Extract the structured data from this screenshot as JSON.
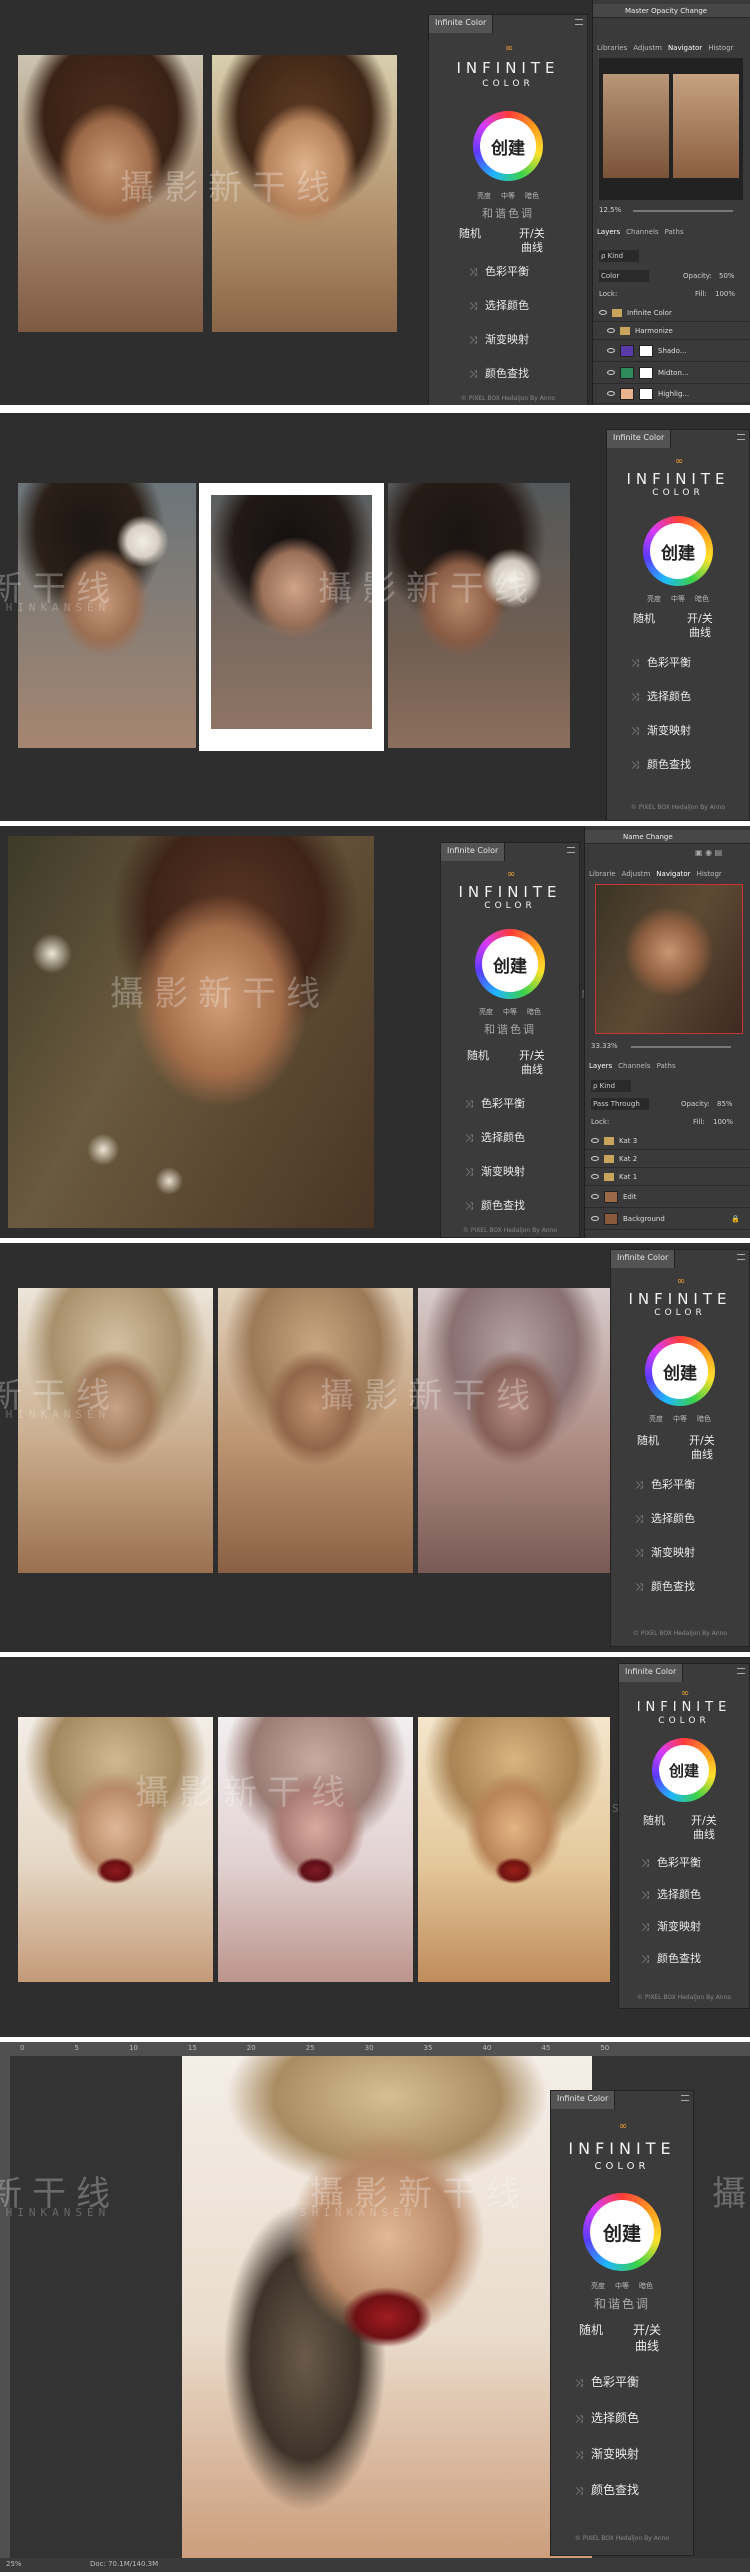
{
  "plugin": {
    "tab_label": "Infinite Color",
    "title": "INFINITE",
    "subtitle": "COLOR",
    "create": "创建",
    "options": [
      "亮度",
      "中等",
      "暗色"
    ],
    "harmony": "和谐色调",
    "random": "随机",
    "toggle_line1": "开/关",
    "toggle_line2": "曲线",
    "actions": [
      "色彩平衡",
      "选择颜色",
      "渐变映射",
      "颜色查找"
    ],
    "footer": "© PIXEL BOX Hedaljon By Anno"
  },
  "watermark": {
    "cn_full": "攝影新干线",
    "cn_short": "新干线",
    "en": "SHINKANSEN",
    "cn_right": "攝"
  },
  "ps1": {
    "history": "Master Opacity Change",
    "tabs": [
      "Libraries",
      "Adjustm",
      "Navigator",
      "Histogr"
    ],
    "zoom": "12.5%",
    "layers_tabs": [
      "Layers",
      "Channels",
      "Paths"
    ],
    "kind": "ρ Kind",
    "blend": "Color",
    "opacity_label": "Opacity:",
    "opacity": "50%",
    "lock": "Lock:",
    "fill_label": "Fill:",
    "fill": "100%",
    "layers": [
      "Infinite Color",
      "Harmonize",
      "Shado...",
      "Midton...",
      "Highlig..."
    ]
  },
  "ps3": {
    "history": "Name Change",
    "tabs": [
      "Librarie",
      "Adjustm",
      "Navigator",
      "Histogr"
    ],
    "zoom": "33.33%",
    "layers_tabs": [
      "Layers",
      "Channels",
      "Paths"
    ],
    "kind": "ρ Kind",
    "blend": "Pass Through",
    "opacity_label": "Opacity:",
    "opacity": "85%",
    "lock": "Lock:",
    "fill_label": "Fill:",
    "fill": "100%",
    "layers": [
      "Kat 3",
      "Kat 2",
      "Kat 1",
      "Edit",
      "Background"
    ]
  },
  "ps6": {
    "ruler_marks": [
      "0",
      "5",
      "10",
      "15",
      "20",
      "25",
      "30",
      "35",
      "40",
      "45",
      "50"
    ],
    "status_zoom": "25%",
    "status_doc": "Doc: 70.1M/140.3M"
  },
  "colors": {
    "accent": "#f0a030",
    "panel": "#3b3b3b",
    "background": "#2e2e2e"
  }
}
